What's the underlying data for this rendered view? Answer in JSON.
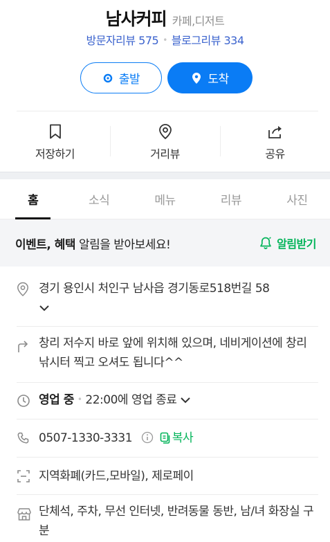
{
  "header": {
    "name": "남사커피",
    "category": "카페,디저트",
    "visitor_reviews": "방문자리뷰 575",
    "blog_reviews": "블로그리뷰 334"
  },
  "route": {
    "depart_label": "출발",
    "arrive_label": "도착"
  },
  "actions": [
    {
      "label": "저장하기",
      "icon": "bookmark-icon"
    },
    {
      "label": "거리뷰",
      "icon": "location-pin-icon"
    },
    {
      "label": "공유",
      "icon": "share-icon"
    }
  ],
  "tabs": [
    {
      "label": "홈",
      "active": true
    },
    {
      "label": "소식",
      "active": false
    },
    {
      "label": "메뉴",
      "active": false
    },
    {
      "label": "리뷰",
      "active": false
    },
    {
      "label": "사진",
      "active": false
    }
  ],
  "event": {
    "bold_text": "이벤트, 혜택",
    "text": " 알림을 받아보세요!",
    "button_label": "알림받기"
  },
  "info": {
    "address": "경기 용인시 처인구 남사읍 경기동로518번길 58",
    "directions": "창리 저수지 바로 앞에 위치해 있으며, 네비게이션에 창리 낚시터 찍고 오셔도 됩니다^^",
    "status": "영업 중",
    "hours": "22:00에 영업 종료",
    "phone": "0507-1330-3331",
    "copy_label": "복사",
    "payment": "지역화폐(카드,모바일), 제로페이",
    "amenities": "단체석, 주차, 무선 인터넷, 반려동물 동반, 남/녀 화장실 구분"
  },
  "colors": {
    "accent_blue": "#0a7cf5",
    "review_blue": "#3b63ce",
    "naver_green": "#03b45a"
  }
}
